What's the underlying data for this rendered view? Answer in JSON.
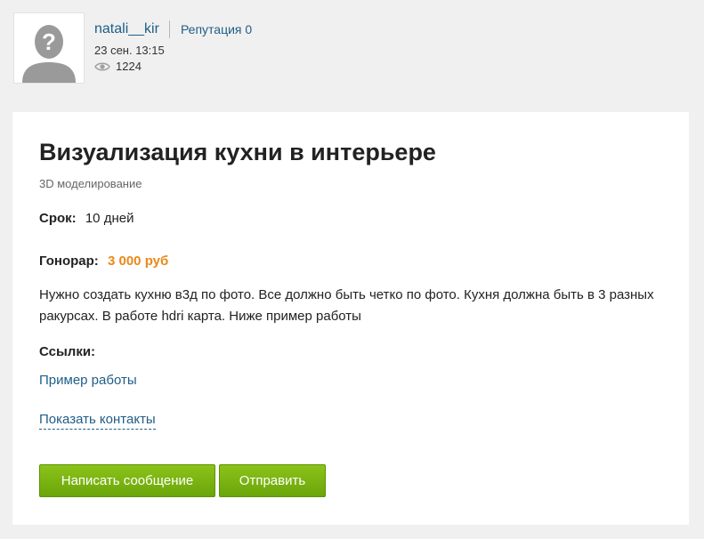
{
  "author": {
    "username": "natali__kir",
    "reputation": "Репутация 0",
    "date": "23 сен. 13:15",
    "views": "1224",
    "avatar_icon": "default-avatar-icon",
    "views_icon": "eye-icon"
  },
  "project": {
    "title": "Визуализация кухни в интерьере",
    "category": "3D моделирование",
    "term_label": "Срок:",
    "term_value": "10 дней",
    "fee_label": "Гонорар:",
    "fee_value": "3 000 руб",
    "description": "Нужно создать кухню в3д по фото. Все должно быть четко по фото. Кухня должна быть в 3 разных ракурсах. В работе hdri карта. Ниже пример работы",
    "links_title": "Ссылки:",
    "links": [
      {
        "label": "Пример работы"
      }
    ],
    "show_contacts": "Показать контакты"
  },
  "actions": {
    "write_message": "Написать сообщение",
    "send": "Отправить"
  },
  "colors": {
    "background": "#f0f0f0",
    "link": "#1f5d87",
    "fee": "#e8891a",
    "button": "#7bb412"
  }
}
